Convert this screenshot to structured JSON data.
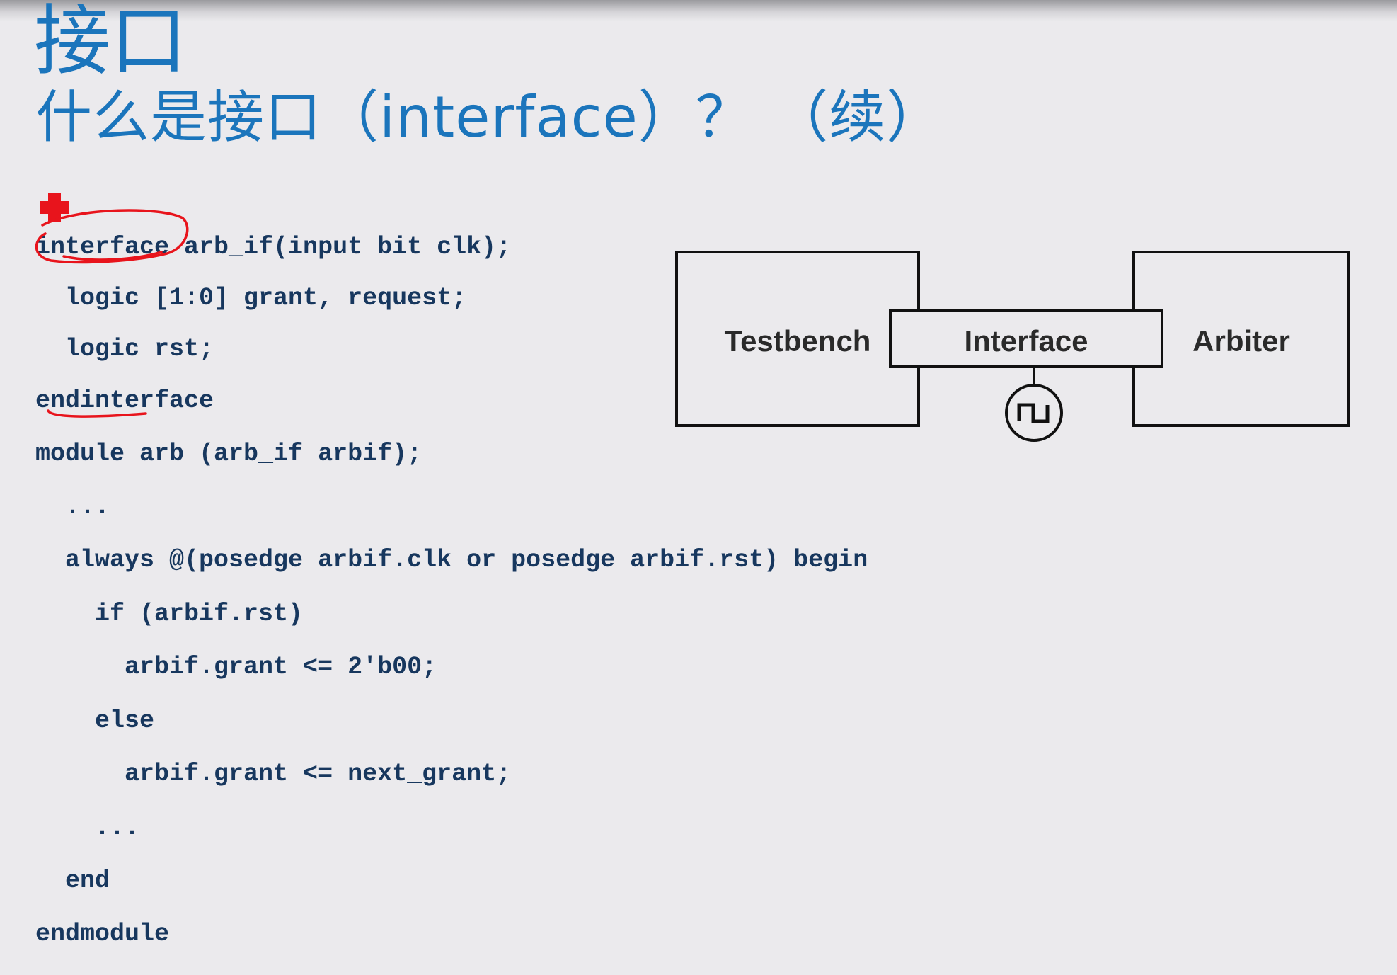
{
  "slide": {
    "title": "接口",
    "subtitle": "什么是接口（interface）？ （续）"
  },
  "code": {
    "lines": [
      "interface arb_if(input bit clk);",
      "  logic [1:0] grant, request;",
      "  logic rst;",
      "endinterface",
      "module arb (arb_if arbif);",
      "  ...",
      "  always @(posedge arbif.clk or posedge arbif.rst) begin",
      "    if (arbif.rst)",
      "      arbif.grant <= 2'b00;",
      "    else",
      "      arbif.grant <= next_grant;",
      "    ...",
      "  end",
      "endmodule"
    ]
  },
  "diagram": {
    "left_box": "Testbench",
    "center_box": "Interface",
    "right_box": "Arbiter",
    "clock_symbol": "clock-waveform-icon"
  },
  "colors": {
    "title": "#1b75bc",
    "code": "#17375e",
    "annotation": "#e8141c",
    "background": "#ebeaed"
  }
}
